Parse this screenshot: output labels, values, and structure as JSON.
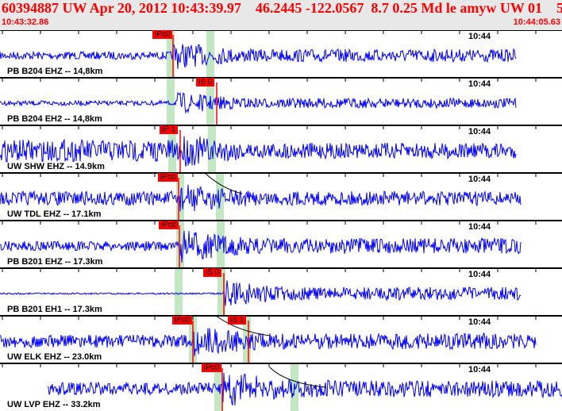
{
  "header": {
    "title": "60394887 UW Apr 20, 2012 10:43:39.97    46.2445 -122.0567  8.7 0.25 Md le amyw UW 01    5",
    "start_time": "10:43:32.86",
    "end_time": "10:44:05.63"
  },
  "traces": [
    {
      "label": "PB B204 EHZ -- 14,8km",
      "time_tick": "10:44",
      "picks": [
        "iPc0"
      ]
    },
    {
      "label": "PB B204 EH2 -- 14,8km",
      "time_tick": "10:44",
      "picks": [
        "iS 0"
      ]
    },
    {
      "label": "UW SHW EHZ -- 14.9km",
      "time_tick": "10:44",
      "picks": [
        "iP 1"
      ]
    },
    {
      "label": "UW TDL EHZ -- 17.1km",
      "time_tick": "10:44",
      "picks": [
        "iPc0"
      ]
    },
    {
      "label": "PB B201 EHZ -- 17.3km",
      "time_tick": "10:44",
      "picks": [
        "iPc0"
      ]
    },
    {
      "label": "PB B201 EH1 -- 17.3km",
      "time_tick": "10:44",
      "picks": [
        "iS 0"
      ]
    },
    {
      "label": "UW ELK EHZ -- 23.0km",
      "time_tick": "10:44",
      "picks": [
        "iPc0",
        "iS 1"
      ]
    },
    {
      "label": "UW LVP EHZ -- 33.2km",
      "time_tick": "10:44",
      "picks": [
        "iPc0"
      ]
    }
  ],
  "colors": {
    "trace": "#0000ff",
    "pick": "#ff0000",
    "window": "#c3e6c3",
    "header": "#e8e8e8"
  }
}
